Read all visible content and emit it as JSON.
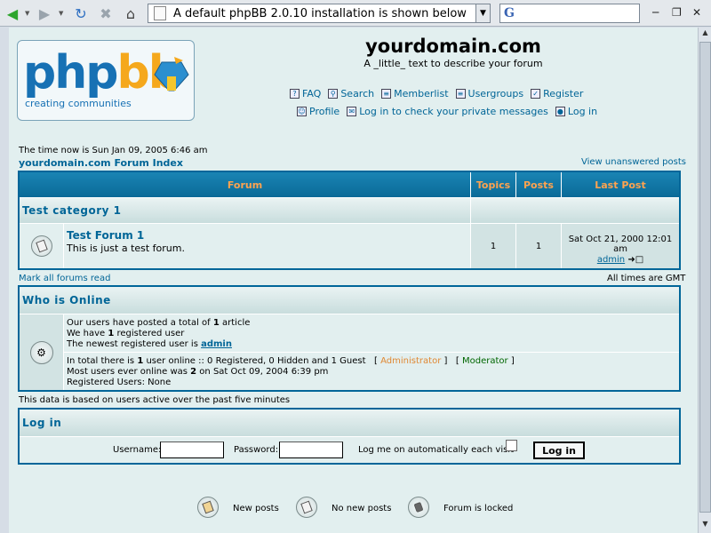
{
  "browser": {
    "address": "A default phpBB 2.0.10 installation is shown below",
    "search_engine_glyph": "G"
  },
  "header": {
    "logo_word_blue": "php",
    "logo_word_orange": "bb",
    "logo_tagline": "creating communities",
    "site_name": "yourdomain.com",
    "site_description": "A _little_ text to describe your forum",
    "menu_row1": [
      "FAQ",
      "Search",
      "Memberlist",
      "Usergroups",
      "Register"
    ],
    "menu_row2": [
      "Profile",
      "Log in to check your private messages",
      "Log in"
    ]
  },
  "time_now": "The time now is Sun Jan 09, 2005 6:46 am",
  "index_link": "yourdomain.com Forum Index",
  "view_unanswered": "View unanswered posts",
  "forum_table": {
    "headers": [
      "Forum",
      "Topics",
      "Posts",
      "Last Post"
    ],
    "category": "Test category 1",
    "forum": {
      "name": "Test Forum 1",
      "description": "This is just a test forum.",
      "topics": "1",
      "posts": "1",
      "last_post_date": "Sat Oct 21, 2000 12:01 am",
      "last_post_user": "admin"
    }
  },
  "mark_all_read": "Mark all forums read",
  "timezone": "All times are GMT",
  "who_online": {
    "title": "Who is Online",
    "total_prefix": "Our users have posted a total of ",
    "total_count": "1",
    "total_suffix": " article",
    "registered_prefix": "We have ",
    "registered_count": "1",
    "registered_suffix": " registered user",
    "newest_prefix": "The newest registered user is ",
    "newest_user": "admin",
    "online_prefix": "In total there is ",
    "online_count": "1",
    "online_suffix": " user online :: 0 Registered, 0 Hidden and 1 Guest",
    "legend_admin": "Administrator",
    "legend_mod": "Moderator",
    "most_prefix": "Most users ever online was ",
    "most_count": "2",
    "most_suffix": " on Sat Oct 09, 2004 6:39 pm",
    "registered_users": "Registered Users: None",
    "colors": {
      "admin": "#e08833",
      "moderator": "#006600"
    }
  },
  "data_note": "This data is based on users active over the past five minutes",
  "login": {
    "title": "Log in",
    "username_label": "Username:",
    "password_label": "Password:",
    "auto_label": "Log me on automatically each visit",
    "button": "Log in"
  },
  "legend": {
    "new_posts": "New posts",
    "no_new_posts": "No new posts",
    "locked": "Forum is locked"
  }
}
